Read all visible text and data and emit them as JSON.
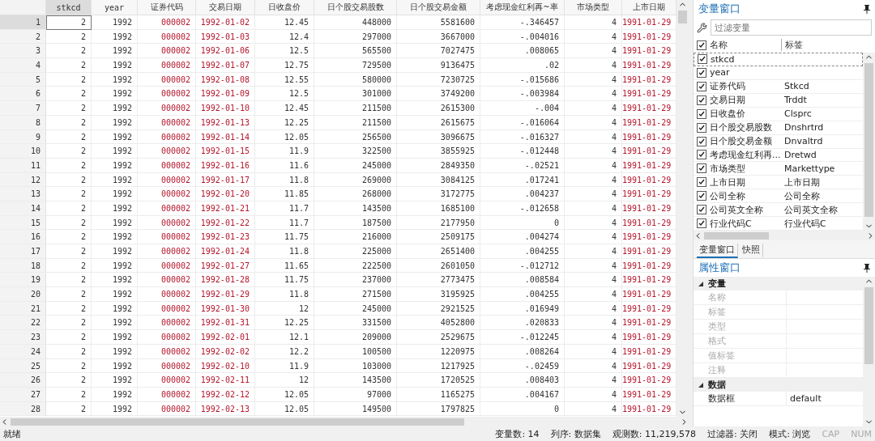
{
  "data_browser": {
    "columns": [
      {
        "label": "stkcd",
        "kind": "numeric",
        "selected": true
      },
      {
        "label": "year",
        "kind": "numeric",
        "selected": false
      },
      {
        "label": "证券代码",
        "kind": "string",
        "selected": false
      },
      {
        "label": "交易日期",
        "kind": "string",
        "selected": false
      },
      {
        "label": "日收盘价",
        "kind": "numeric",
        "selected": false
      },
      {
        "label": "日个股交易股数",
        "kind": "numeric",
        "selected": false
      },
      {
        "label": "日个股交易金额",
        "kind": "numeric",
        "selected": false
      },
      {
        "label": "考虑现金红利再~率",
        "kind": "numeric",
        "selected": false
      },
      {
        "label": "市场类型",
        "kind": "numeric",
        "selected": false
      },
      {
        "label": "上市日期",
        "kind": "string",
        "selected": false
      }
    ],
    "rows": [
      {
        "number": "1",
        "selected": true,
        "cells": [
          "2",
          "1992",
          "000002",
          "1992-01-02",
          "12.45",
          "448000",
          "5581600",
          "-.346457",
          "4",
          "1991-01-29"
        ]
      },
      {
        "number": "2",
        "selected": false,
        "cells": [
          "2",
          "1992",
          "000002",
          "1992-01-03",
          "12.4",
          "297000",
          "3667000",
          "-.004016",
          "4",
          "1991-01-29"
        ]
      },
      {
        "number": "3",
        "selected": false,
        "cells": [
          "2",
          "1992",
          "000002",
          "1992-01-06",
          "12.5",
          "565500",
          "7027475",
          ".008065",
          "4",
          "1991-01-29"
        ]
      },
      {
        "number": "4",
        "selected": false,
        "cells": [
          "2",
          "1992",
          "000002",
          "1992-01-07",
          "12.75",
          "729500",
          "9136475",
          ".02",
          "4",
          "1991-01-29"
        ]
      },
      {
        "number": "5",
        "selected": false,
        "cells": [
          "2",
          "1992",
          "000002",
          "1992-01-08",
          "12.55",
          "580000",
          "7230725",
          "-.015686",
          "4",
          "1991-01-29"
        ]
      },
      {
        "number": "6",
        "selected": false,
        "cells": [
          "2",
          "1992",
          "000002",
          "1992-01-09",
          "12.5",
          "301000",
          "3749200",
          "-.003984",
          "4",
          "1991-01-29"
        ]
      },
      {
        "number": "7",
        "selected": false,
        "cells": [
          "2",
          "1992",
          "000002",
          "1992-01-10",
          "12.45",
          "211500",
          "2615300",
          "-.004",
          "4",
          "1991-01-29"
        ]
      },
      {
        "number": "8",
        "selected": false,
        "cells": [
          "2",
          "1992",
          "000002",
          "1992-01-13",
          "12.25",
          "211500",
          "2615675",
          "-.016064",
          "4",
          "1991-01-29"
        ]
      },
      {
        "number": "9",
        "selected": false,
        "cells": [
          "2",
          "1992",
          "000002",
          "1992-01-14",
          "12.05",
          "256500",
          "3096675",
          "-.016327",
          "4",
          "1991-01-29"
        ]
      },
      {
        "number": "10",
        "selected": false,
        "cells": [
          "2",
          "1992",
          "000002",
          "1992-01-15",
          "11.9",
          "322500",
          "3855925",
          "-.012448",
          "4",
          "1991-01-29"
        ]
      },
      {
        "number": "11",
        "selected": false,
        "cells": [
          "2",
          "1992",
          "000002",
          "1992-01-16",
          "11.6",
          "245000",
          "2849350",
          "-.02521",
          "4",
          "1991-01-29"
        ]
      },
      {
        "number": "12",
        "selected": false,
        "cells": [
          "2",
          "1992",
          "000002",
          "1992-01-17",
          "11.8",
          "269000",
          "3084125",
          ".017241",
          "4",
          "1991-01-29"
        ]
      },
      {
        "number": "13",
        "selected": false,
        "cells": [
          "2",
          "1992",
          "000002",
          "1992-01-20",
          "11.85",
          "268000",
          "3172775",
          ".004237",
          "4",
          "1991-01-29"
        ]
      },
      {
        "number": "14",
        "selected": false,
        "cells": [
          "2",
          "1992",
          "000002",
          "1992-01-21",
          "11.7",
          "143500",
          "1685100",
          "-.012658",
          "4",
          "1991-01-29"
        ]
      },
      {
        "number": "15",
        "selected": false,
        "cells": [
          "2",
          "1992",
          "000002",
          "1992-01-22",
          "11.7",
          "187500",
          "2177950",
          "0",
          "4",
          "1991-01-29"
        ]
      },
      {
        "number": "16",
        "selected": false,
        "cells": [
          "2",
          "1992",
          "000002",
          "1992-01-23",
          "11.75",
          "216000",
          "2509175",
          ".004274",
          "4",
          "1991-01-29"
        ]
      },
      {
        "number": "17",
        "selected": false,
        "cells": [
          "2",
          "1992",
          "000002",
          "1992-01-24",
          "11.8",
          "225000",
          "2651400",
          ".004255",
          "4",
          "1991-01-29"
        ]
      },
      {
        "number": "18",
        "selected": false,
        "cells": [
          "2",
          "1992",
          "000002",
          "1992-01-27",
          "11.65",
          "222500",
          "2601050",
          "-.012712",
          "4",
          "1991-01-29"
        ]
      },
      {
        "number": "19",
        "selected": false,
        "cells": [
          "2",
          "1992",
          "000002",
          "1992-01-28",
          "11.75",
          "237000",
          "2773475",
          ".008584",
          "4",
          "1991-01-29"
        ]
      },
      {
        "number": "20",
        "selected": false,
        "cells": [
          "2",
          "1992",
          "000002",
          "1992-01-29",
          "11.8",
          "271500",
          "3195925",
          ".004255",
          "4",
          "1991-01-29"
        ]
      },
      {
        "number": "21",
        "selected": false,
        "cells": [
          "2",
          "1992",
          "000002",
          "1992-01-30",
          "12",
          "245000",
          "2921525",
          ".016949",
          "4",
          "1991-01-29"
        ]
      },
      {
        "number": "22",
        "selected": false,
        "cells": [
          "2",
          "1992",
          "000002",
          "1992-01-31",
          "12.25",
          "331500",
          "4052800",
          ".020833",
          "4",
          "1991-01-29"
        ]
      },
      {
        "number": "23",
        "selected": false,
        "cells": [
          "2",
          "1992",
          "000002",
          "1992-02-01",
          "12.1",
          "209000",
          "2529675",
          "-.012245",
          "4",
          "1991-01-29"
        ]
      },
      {
        "number": "24",
        "selected": false,
        "cells": [
          "2",
          "1992",
          "000002",
          "1992-02-02",
          "12.2",
          "100500",
          "1220975",
          ".008264",
          "4",
          "1991-01-29"
        ]
      },
      {
        "number": "25",
        "selected": false,
        "cells": [
          "2",
          "1992",
          "000002",
          "1992-02-10",
          "11.9",
          "103000",
          "1217925",
          "-.02459",
          "4",
          "1991-01-29"
        ]
      },
      {
        "number": "26",
        "selected": false,
        "cells": [
          "2",
          "1992",
          "000002",
          "1992-02-11",
          "12",
          "143500",
          "1720525",
          ".008403",
          "4",
          "1991-01-29"
        ]
      },
      {
        "number": "27",
        "selected": false,
        "cells": [
          "2",
          "1992",
          "000002",
          "1992-02-12",
          "12.05",
          "97000",
          "1165275",
          ".004167",
          "4",
          "1991-01-29"
        ]
      },
      {
        "number": "28",
        "selected": false,
        "cells": [
          "2",
          "1992",
          "000002",
          "1992-02-13",
          "12.05",
          "149500",
          "1797825",
          "0",
          "4",
          "1991-01-29"
        ]
      }
    ]
  },
  "variables_window": {
    "title": "变量窗口",
    "filter": {
      "placeholder": "过滤变量"
    },
    "header": {
      "all_checked": true,
      "name": "名称",
      "label": "标签"
    },
    "variables": [
      {
        "name": "stkcd",
        "checked": true,
        "selected": true
      },
      {
        "name": "year",
        "checked": true,
        "selected": false
      },
      {
        "name": "证券代码",
        "label": "Stkcd",
        "checked": true,
        "selected": false
      },
      {
        "name": "交易日期",
        "label": "Trddt",
        "checked": true,
        "selected": false
      },
      {
        "name": "日收盘价",
        "label": "Clsprc",
        "checked": true,
        "selected": false
      },
      {
        "name": "日个股交易股数",
        "label": "Dnshrtrd",
        "checked": true,
        "selected": false
      },
      {
        "name": "日个股交易金额",
        "label": "Dnvaltrd",
        "checked": true,
        "selected": false
      },
      {
        "name": "考虑现金红利再...",
        "label": "Dretwd",
        "checked": true,
        "selected": false
      },
      {
        "name": "市场类型",
        "label": "Markettype",
        "checked": true,
        "selected": false
      },
      {
        "name": "上市日期",
        "label": "上市日期",
        "checked": true,
        "selected": false
      },
      {
        "name": "公司全称",
        "label": "公司全称",
        "checked": true,
        "selected": false
      },
      {
        "name": "公司英文全称",
        "label": "公司英文全称",
        "checked": true,
        "selected": false
      },
      {
        "name": "行业代码C",
        "label": "行业代码C",
        "checked": true,
        "selected": false
      }
    ]
  },
  "tabs": [
    {
      "label": "变量窗口",
      "selected": true
    },
    {
      "label": "快照",
      "selected": false
    }
  ],
  "properties_window": {
    "title": "属性窗口",
    "groups": [
      {
        "name": "变量",
        "expanded": true,
        "rows": [
          {
            "name": "名称",
            "disabled": true
          },
          {
            "name": "标签",
            "disabled": true
          },
          {
            "name": "类型",
            "disabled": true
          },
          {
            "name": "格式",
            "disabled": true
          },
          {
            "name": "值标签",
            "disabled": true
          },
          {
            "name": "注释",
            "disabled": true
          }
        ]
      },
      {
        "name": "数据",
        "expanded": true,
        "rows": [
          {
            "name": "数据框",
            "value": "default",
            "disabled": false
          }
        ]
      }
    ]
  },
  "status_bar": {
    "message": "就绪",
    "items": [
      "变量数: 14",
      "列序: 数据集",
      "观测数: 11,219,578",
      "过滤器: 关闭",
      "模式: 浏览"
    ],
    "indicators": [
      {
        "label": "CAP",
        "on": false
      },
      {
        "label": "NUM",
        "on": false
      }
    ]
  }
}
